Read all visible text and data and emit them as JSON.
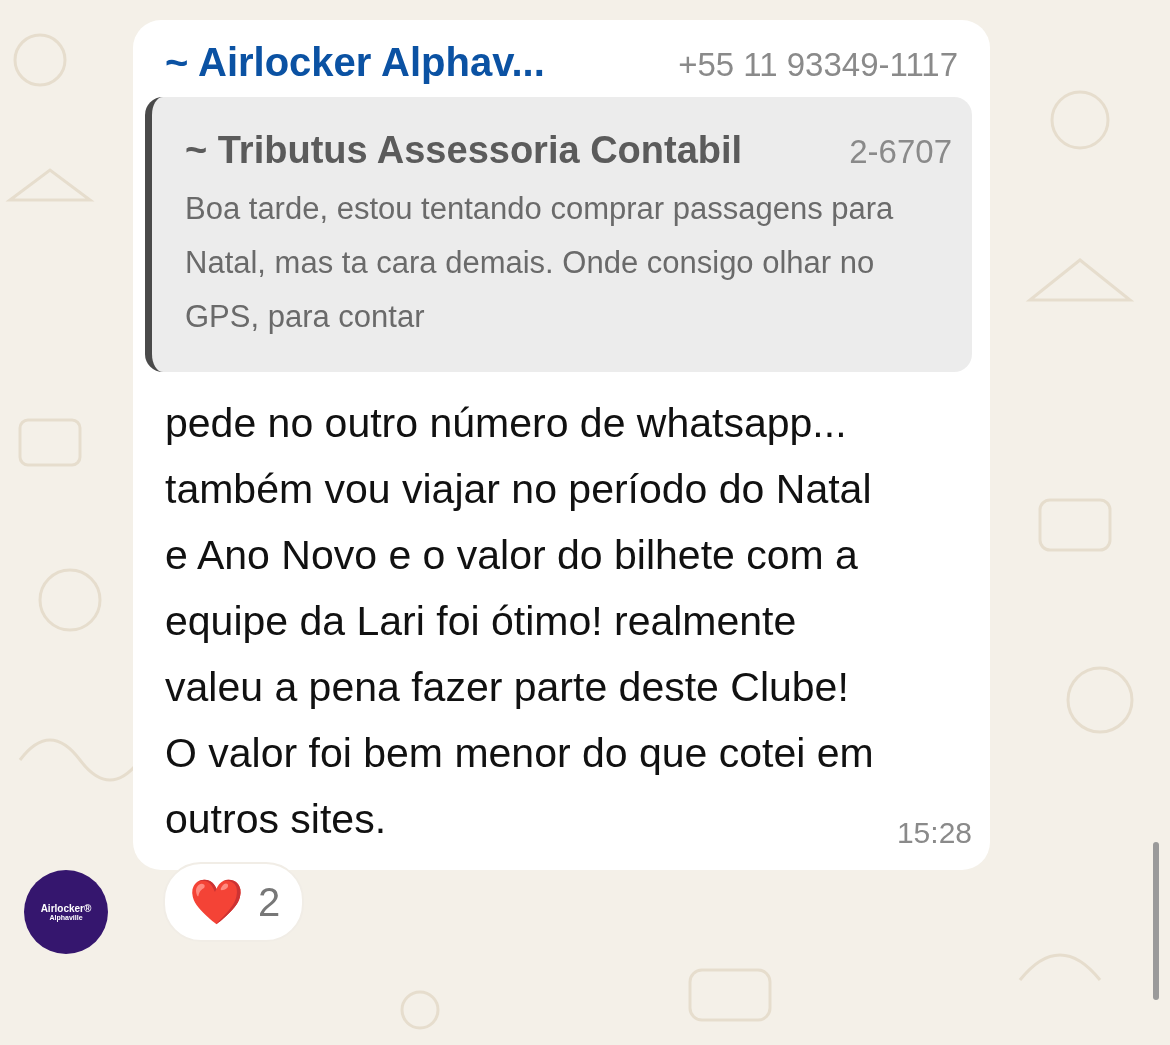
{
  "message": {
    "sender_name": "~ Airlocker Alphav...",
    "sender_phone": "+55 11 93349-1117",
    "quote": {
      "name": "~ Tributus Assessoria Contabil",
      "phone": "2-6707",
      "text": "Boa tarde, estou tentando comprar passagens para Natal, mas ta cara demais. Onde consigo olhar no GPS, para contar"
    },
    "text": "pede no outro número de whatsapp... também vou viajar no período do Natal e Ano Novo e o valor do bilhete com a equipe da Lari foi ótimo! realmente valeu a pena fazer parte deste Clube!  O valor foi bem menor do que cotei em outros sites.",
    "time": "15:28",
    "avatar": {
      "title": "Airlocker®",
      "subtitle": "Alphaville"
    },
    "reactions": [
      {
        "emoji": "❤️",
        "count": "2"
      }
    ]
  }
}
